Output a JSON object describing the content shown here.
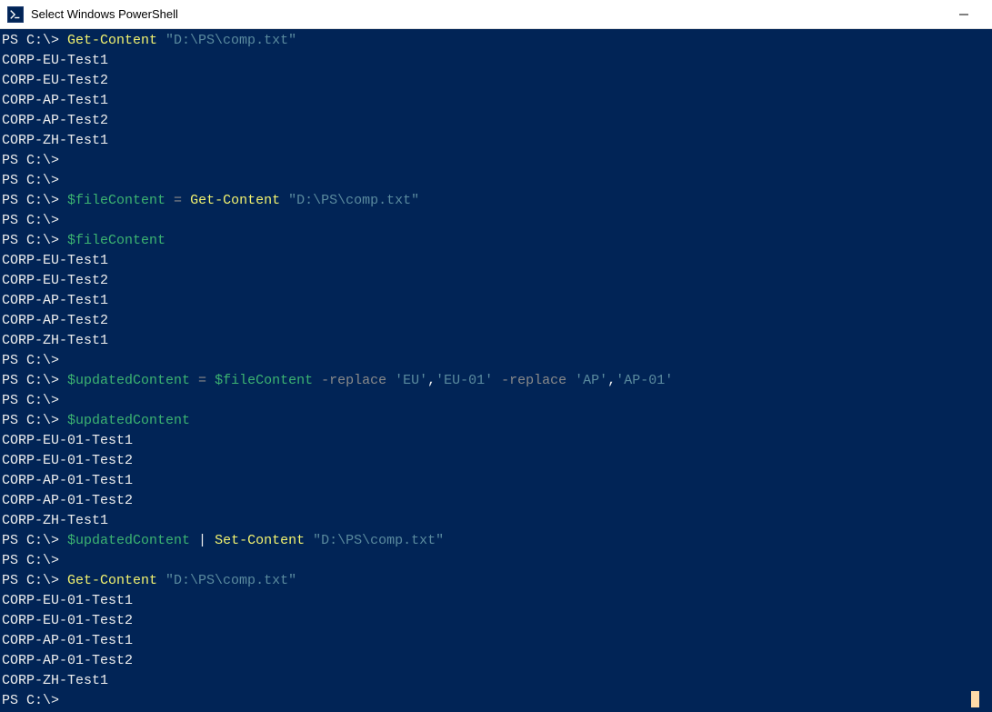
{
  "window": {
    "title": "Select Windows PowerShell"
  },
  "colors": {
    "terminal_bg": "#012456",
    "prompt": "#eeeeee",
    "cmdlet": "#f2f26f",
    "variable": "#3cb371",
    "string": "#5a8a9e",
    "operator": "#8a8a8a",
    "literal": "#d78d82",
    "output": "#eeeeee"
  },
  "lines": [
    [
      {
        "t": "PS C:\\> ",
        "c": "c-white"
      },
      {
        "t": "Get-Content ",
        "c": "c-yellow"
      },
      {
        "t": "\"D:\\PS\\comp.txt\"",
        "c": "c-darkcyan"
      }
    ],
    [
      {
        "t": "CORP-EU-Test1",
        "c": "c-white"
      }
    ],
    [
      {
        "t": "CORP-EU-Test2",
        "c": "c-white"
      }
    ],
    [
      {
        "t": "CORP-AP-Test1",
        "c": "c-white"
      }
    ],
    [
      {
        "t": "CORP-AP-Test2",
        "c": "c-white"
      }
    ],
    [
      {
        "t": "CORP-ZH-Test1",
        "c": "c-white"
      }
    ],
    [
      {
        "t": "PS C:\\>",
        "c": "c-white"
      }
    ],
    [
      {
        "t": "PS C:\\>",
        "c": "c-white"
      }
    ],
    [
      {
        "t": "PS C:\\> ",
        "c": "c-white"
      },
      {
        "t": "$fileContent ",
        "c": "c-green"
      },
      {
        "t": "= ",
        "c": "c-gray"
      },
      {
        "t": "Get-Content ",
        "c": "c-yellow"
      },
      {
        "t": "\"D:\\PS\\comp.txt\"",
        "c": "c-darkcyan"
      }
    ],
    [
      {
        "t": "PS C:\\>",
        "c": "c-white"
      }
    ],
    [
      {
        "t": "PS C:\\> ",
        "c": "c-white"
      },
      {
        "t": "$fileContent",
        "c": "c-green"
      }
    ],
    [
      {
        "t": "CORP-EU-Test1",
        "c": "c-white"
      }
    ],
    [
      {
        "t": "CORP-EU-Test2",
        "c": "c-white"
      }
    ],
    [
      {
        "t": "CORP-AP-Test1",
        "c": "c-white"
      }
    ],
    [
      {
        "t": "CORP-AP-Test2",
        "c": "c-white"
      }
    ],
    [
      {
        "t": "CORP-ZH-Test1",
        "c": "c-white"
      }
    ],
    [
      {
        "t": "PS C:\\>",
        "c": "c-white"
      }
    ],
    [
      {
        "t": "PS C:\\> ",
        "c": "c-white"
      },
      {
        "t": "$updatedContent ",
        "c": "c-green"
      },
      {
        "t": "= ",
        "c": "c-gray"
      },
      {
        "t": "$fileContent ",
        "c": "c-green"
      },
      {
        "t": "-replace ",
        "c": "c-gray"
      },
      {
        "t": "'EU'",
        "c": "c-darkcyan"
      },
      {
        "t": ",",
        "c": "c-white"
      },
      {
        "t": "'EU-01' ",
        "c": "c-darkcyan"
      },
      {
        "t": "-replace ",
        "c": "c-gray"
      },
      {
        "t": "'AP'",
        "c": "c-darkcyan"
      },
      {
        "t": ",",
        "c": "c-white"
      },
      {
        "t": "'AP-01'",
        "c": "c-darkcyan"
      }
    ],
    [
      {
        "t": "PS C:\\>",
        "c": "c-white"
      }
    ],
    [
      {
        "t": "PS C:\\> ",
        "c": "c-white"
      },
      {
        "t": "$updatedContent",
        "c": "c-green"
      }
    ],
    [
      {
        "t": "CORP-EU-01-Test1",
        "c": "c-white"
      }
    ],
    [
      {
        "t": "CORP-EU-01-Test2",
        "c": "c-white"
      }
    ],
    [
      {
        "t": "CORP-AP-01-Test1",
        "c": "c-white"
      }
    ],
    [
      {
        "t": "CORP-AP-01-Test2",
        "c": "c-white"
      }
    ],
    [
      {
        "t": "CORP-ZH-Test1",
        "c": "c-white"
      }
    ],
    [
      {
        "t": "PS C:\\> ",
        "c": "c-white"
      },
      {
        "t": "$updatedContent ",
        "c": "c-green"
      },
      {
        "t": "| ",
        "c": "c-white"
      },
      {
        "t": "Set-Content ",
        "c": "c-yellow"
      },
      {
        "t": "\"D:\\PS\\comp.txt\"",
        "c": "c-darkcyan"
      }
    ],
    [
      {
        "t": "PS C:\\>",
        "c": "c-white"
      }
    ],
    [
      {
        "t": "PS C:\\> ",
        "c": "c-white"
      },
      {
        "t": "Get-Content ",
        "c": "c-yellow"
      },
      {
        "t": "\"D:\\PS\\comp.txt\"",
        "c": "c-darkcyan"
      }
    ],
    [
      {
        "t": "CORP-EU-01-Test1",
        "c": "c-white"
      }
    ],
    [
      {
        "t": "CORP-EU-01-Test2",
        "c": "c-white"
      }
    ],
    [
      {
        "t": "CORP-AP-01-Test1",
        "c": "c-white"
      }
    ],
    [
      {
        "t": "CORP-AP-01-Test2",
        "c": "c-white"
      }
    ],
    [
      {
        "t": "CORP-ZH-Test1",
        "c": "c-white"
      }
    ],
    [
      {
        "t": "PS C:\\>",
        "c": "c-white"
      }
    ]
  ]
}
